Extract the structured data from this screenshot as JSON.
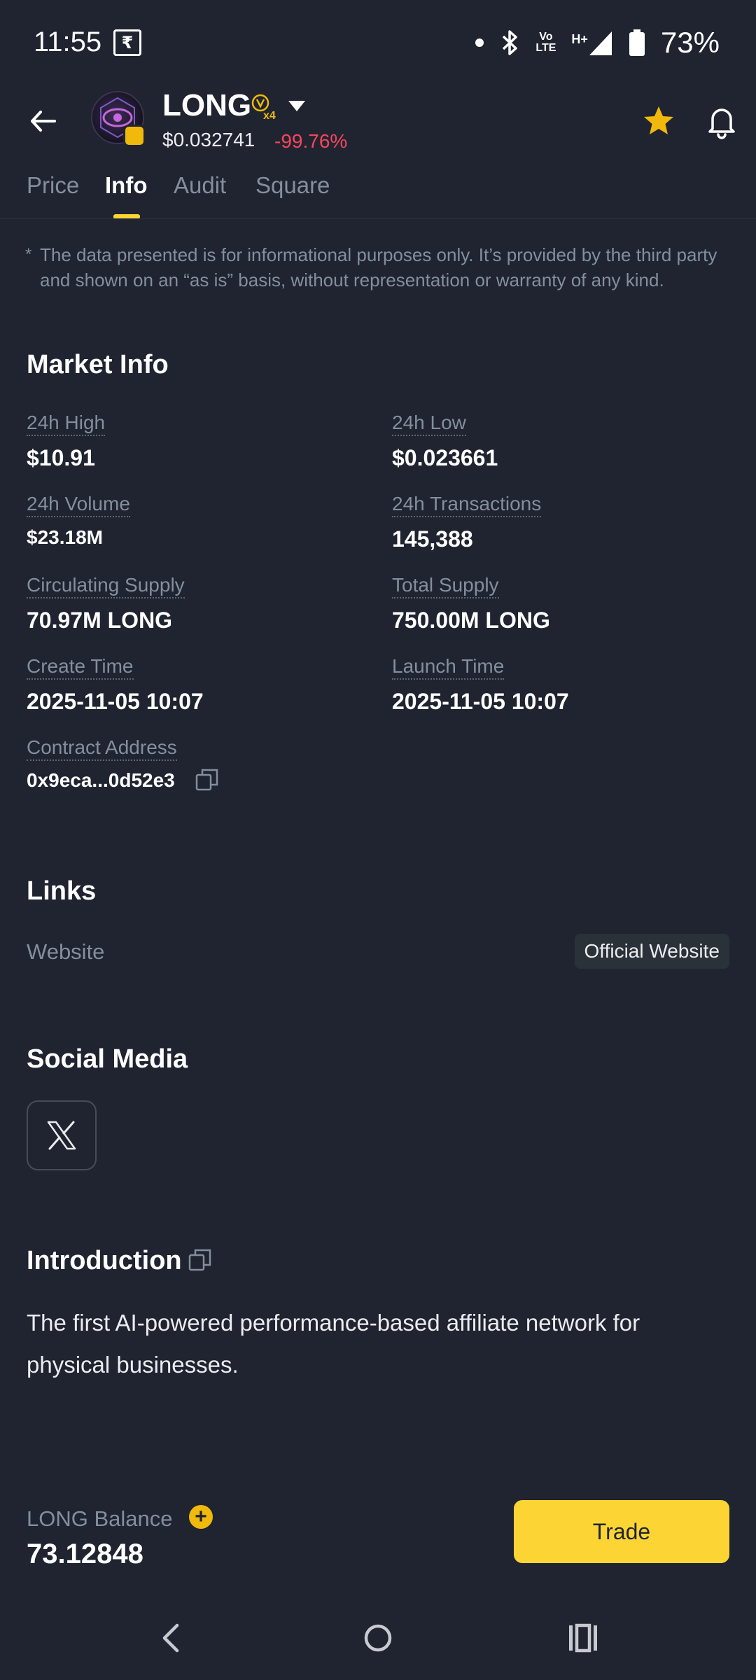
{
  "status_bar": {
    "time": "11:55",
    "r_icon": "₹",
    "network_lte": [
      "Vo",
      "LTE"
    ],
    "network_hplus": "H+",
    "battery": "73%"
  },
  "header": {
    "token_name": "LONG",
    "v_badge": "x4",
    "price": "$0.032741",
    "change": "-99.76%",
    "favorite": true
  },
  "tabs": [
    {
      "label": "Price",
      "active": false
    },
    {
      "label": "Info",
      "active": true
    },
    {
      "label": "Audit",
      "active": false
    },
    {
      "label": "Square",
      "active": false
    }
  ],
  "disclaimer": {
    "star": "*",
    "text": "The data presented is for informational purposes only. It’s provided by the third party and shown on an “as is” basis, without representation or warranty of any kind."
  },
  "market_info": {
    "title": "Market Info",
    "high_label": "24h High",
    "high_value": "$10.91",
    "low_label": "24h Low",
    "low_value": "$0.023661",
    "volume_label": "24h Volume",
    "volume_value": "$23.18M",
    "tx_label": "24h Transactions",
    "tx_value": "145,388",
    "circ_label": "Circulating Supply",
    "circ_value": "70.97M LONG",
    "total_label": "Total Supply",
    "total_value": "750.00M LONG",
    "create_label": "Create Time",
    "create_value": "2025-11-05 10:07",
    "launch_label": "Launch Time",
    "launch_value": "2025-11-05 10:07",
    "contract_label": "Contract Address",
    "contract_value": "0x9eca...0d52e3"
  },
  "links": {
    "title": "Links",
    "website_label": "Website",
    "website_button": "Official Website"
  },
  "social": {
    "title": "Social Media",
    "x_icon": "x-logo-icon"
  },
  "intro": {
    "title": "Introduction",
    "text": "The first AI-powered performance-based affiliate network for physical businesses."
  },
  "balance": {
    "label": "LONG Balance",
    "value": "73.12848",
    "plus": "+"
  },
  "trade_button": "Trade",
  "colors": {
    "background": "#1f2430",
    "accent": "#fcd535",
    "negative": "#f6465d",
    "muted": "#848e9c"
  }
}
